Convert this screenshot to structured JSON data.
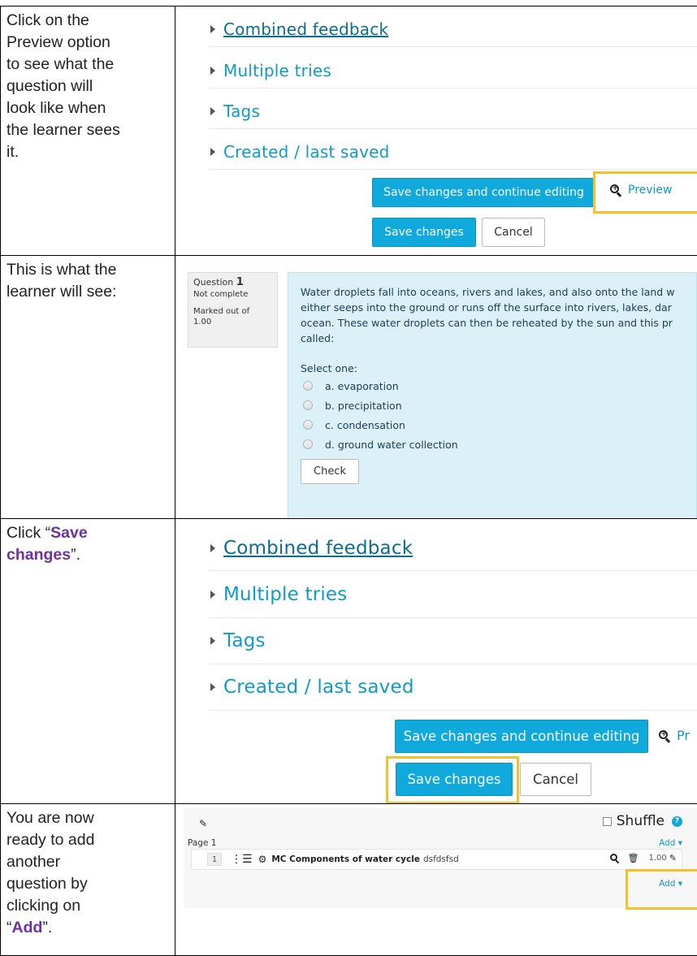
{
  "rows": [
    {
      "instruction_lines": [
        "Click on the",
        "Preview option",
        "to see what the",
        "question will",
        "look like when",
        "the learner sees",
        "it."
      ],
      "sections": [
        "Combined feedback",
        "Multiple tries",
        "Tags",
        "Created / last saved"
      ],
      "buttons": {
        "save_continue": "Save changes and continue editing",
        "preview": "Preview",
        "save": "Save changes",
        "cancel": "Cancel"
      }
    },
    {
      "instruction_lines": [
        "This is what the",
        "learner will see:"
      ],
      "question": {
        "label": "Question",
        "number": "1",
        "status": "Not complete",
        "mark_line1": "Marked out of",
        "mark_line2": "1.00",
        "text_lines": [
          "Water droplets fall into oceans, rivers and lakes, and also onto the land w",
          "either seeps into the ground or runs off the surface into rivers, lakes, dar",
          "ocean. These water droplets can then be reheated by the sun and this pr",
          "called:"
        ],
        "select_prompt": "Select one:",
        "options": [
          "a. evaporation",
          "b. precipitation",
          "c. condensation",
          "d. ground water collection"
        ],
        "check_label": "Check"
      }
    },
    {
      "instruction_before": "Click “",
      "instruction_emphasis_1": "Save",
      "instruction_emphasis_2": "changes",
      "instruction_after": "”.",
      "sections": [
        "Combined feedback",
        "Multiple tries",
        "Tags",
        "Created / last saved"
      ],
      "buttons": {
        "save_continue": "Save changes and continue editing",
        "preview": "Pr",
        "save": "Save changes",
        "cancel": "Cancel"
      }
    },
    {
      "instruction_lines": [
        "You are now",
        "ready to add",
        "another",
        "question by",
        "clicking on"
      ],
      "instruction_quote_open": "“",
      "instruction_emphasis": "Add",
      "instruction_quote_close": "”.",
      "quiz": {
        "shuffle_label": "Shuffle",
        "page_label": "Page 1",
        "add_label": "Add ▾",
        "slot_number": "1",
        "question_name": "MC Components of water cycle",
        "question_text": "dsfdsfsd",
        "mark": "1.00"
      }
    }
  ],
  "colors": {
    "accent": "#0fa9dc",
    "highlight": "#f5c12a",
    "emphasis": "#7030a0",
    "question_bg": "#dcf0f8"
  }
}
